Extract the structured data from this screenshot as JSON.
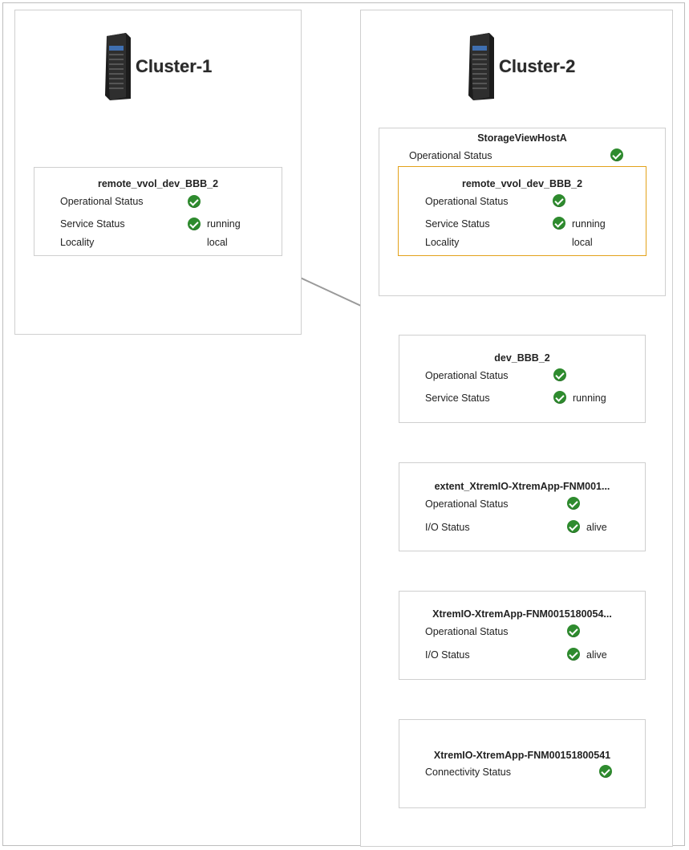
{
  "clusters": [
    {
      "name": "Cluster-1"
    },
    {
      "name": "Cluster-2"
    }
  ],
  "labels": {
    "operational_status": "Operational Status",
    "service_status": "Service Status",
    "locality": "Locality",
    "io_status": "I/O Status",
    "connectivity_status": "Connectivity Status"
  },
  "cards": {
    "c1_vvol": {
      "title": "remote_vvol_dev_BBB_2",
      "operational": "ok",
      "service": "running",
      "locality": "local"
    },
    "storage_view": {
      "title": "StorageViewHostA",
      "operational": "ok"
    },
    "c2_vvol": {
      "title": "remote_vvol_dev_BBB_2",
      "operational": "ok",
      "service": "running",
      "locality": "local",
      "selected": true
    },
    "device": {
      "title": "dev_BBB_2",
      "operational": "ok",
      "service": "running"
    },
    "extent": {
      "title": "extent_XtremIO-XtremApp-FNM001...",
      "operational": "ok",
      "io": "alive"
    },
    "storage_volume": {
      "title": "XtremIO-XtremApp-FNM0015180054...",
      "operational": "ok",
      "io": "alive"
    },
    "array": {
      "title": "XtremIO-XtremApp-FNM00151800541",
      "connectivity": "ok"
    }
  },
  "colors": {
    "ok": "#2e8b2e",
    "selected_border": "#e3a21a",
    "connector": "#9a9a9a"
  }
}
